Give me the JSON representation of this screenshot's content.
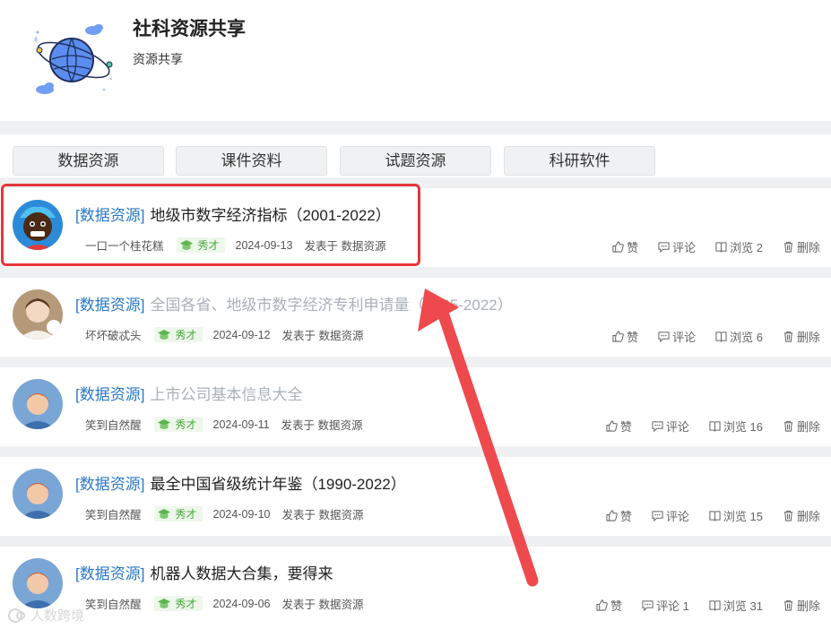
{
  "group": {
    "title": "社科资源共享",
    "subtitle": "资源共享"
  },
  "tabs": [
    {
      "label": "数据资源"
    },
    {
      "label": "课件资料"
    },
    {
      "label": "试题资源"
    },
    {
      "label": "科研软件"
    }
  ],
  "posts": [
    {
      "tag": "[数据资源]",
      "title": "地级市数字经济指标（2001-2022）",
      "title_muted": false,
      "author": "一口一个桂花糕",
      "badge": "秀才",
      "date": "2024-09-13",
      "posted_in": "发表于 数据资源",
      "like": "赞",
      "comment": "评论",
      "views": "浏览 2",
      "delete": "删除"
    },
    {
      "tag": "[数据资源]",
      "title": "全国各省、地级市数字经济专利申请量（1985-2022）",
      "title_muted": true,
      "author": "坏坏破忒头",
      "badge": "秀才",
      "date": "2024-09-12",
      "posted_in": "发表于 数据资源",
      "like": "赞",
      "comment": "评论",
      "views": "浏览 6",
      "delete": "删除"
    },
    {
      "tag": "[数据资源]",
      "title": "上市公司基本信息大全",
      "title_muted": true,
      "author": "笑到自然醒",
      "badge": "秀才",
      "date": "2024-09-11",
      "posted_in": "发表于 数据资源",
      "like": "赞",
      "comment": "评论",
      "views": "浏览 16",
      "delete": "删除"
    },
    {
      "tag": "[数据资源]",
      "title": "最全中国省级统计年鉴（1990-2022）",
      "title_muted": false,
      "author": "笑到自然醒",
      "badge": "秀才",
      "date": "2024-09-10",
      "posted_in": "发表于 数据资源",
      "like": "赞",
      "comment": "评论",
      "views": "浏览 15",
      "delete": "删除"
    },
    {
      "tag": "[数据资源]",
      "title": "机器人数据大合集，要得来",
      "title_muted": false,
      "author": "笑到自然醒",
      "badge": "秀才",
      "date": "2024-09-06",
      "posted_in": "发表于 数据资源",
      "like": "赞",
      "comment": "评论 1",
      "views": "浏览 31",
      "delete": "删除"
    }
  ],
  "watermark": "人数跨境",
  "colors": {
    "tag": "#2a78c8",
    "highlight": "#e6363b",
    "badge": "#4aa640"
  }
}
